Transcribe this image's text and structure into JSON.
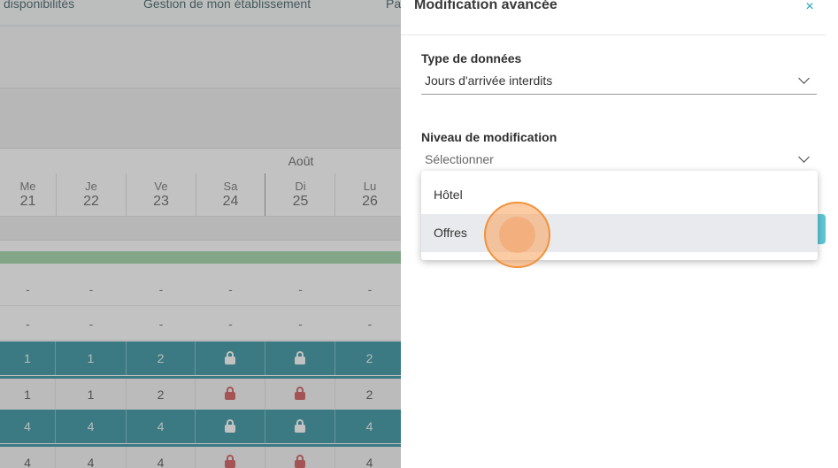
{
  "nav": {
    "items": [
      "disponibilités",
      "Gestion de mon établissement",
      "Pa"
    ]
  },
  "calendar": {
    "month": "Août",
    "days": [
      {
        "name": "Me",
        "num": "21"
      },
      {
        "name": "Je",
        "num": "22"
      },
      {
        "name": "Ve",
        "num": "23"
      },
      {
        "name": "Sa",
        "num": "24"
      },
      {
        "name": "Di",
        "num": "25"
      },
      {
        "name": "Lu",
        "num": "26"
      }
    ],
    "rows": [
      {
        "style": "plain",
        "cells": [
          "-",
          "-",
          "-",
          "-",
          "-",
          "-"
        ]
      },
      {
        "style": "plain",
        "cells": [
          "-",
          "-",
          "-",
          "-",
          "-",
          "-"
        ]
      },
      {
        "style": "teal",
        "cells": [
          "1",
          "1",
          "2",
          "lock",
          "lock",
          "2"
        ]
      },
      {
        "style": "light",
        "cells": [
          "1",
          "1",
          "2",
          "lock",
          "lock",
          "2"
        ]
      },
      {
        "style": "teal",
        "cells": [
          "4",
          "4",
          "4",
          "lock",
          "lock",
          "4"
        ]
      },
      {
        "style": "light",
        "cells": [
          "4",
          "4",
          "4",
          "lock",
          "lock",
          "4"
        ]
      }
    ]
  },
  "panel": {
    "title": "Modification avancée",
    "close_glyph": "×",
    "data_type": {
      "label": "Type de données",
      "value": "Jours d'arrivée interdits"
    },
    "modif_level": {
      "label": "Niveau de modification",
      "placeholder": "Sélectionner",
      "options": [
        "Hôtel",
        "Offres"
      ],
      "highlighted": "Offres"
    }
  },
  "colors": {
    "teal": "#0b7c8c",
    "accent": "#1aa3b5",
    "lock_red": "#c8383a",
    "click_ring": "#f1923c"
  },
  "icons": {
    "close": "close-icon",
    "chevron": "chevron-down-icon",
    "lock": "lock-icon"
  }
}
